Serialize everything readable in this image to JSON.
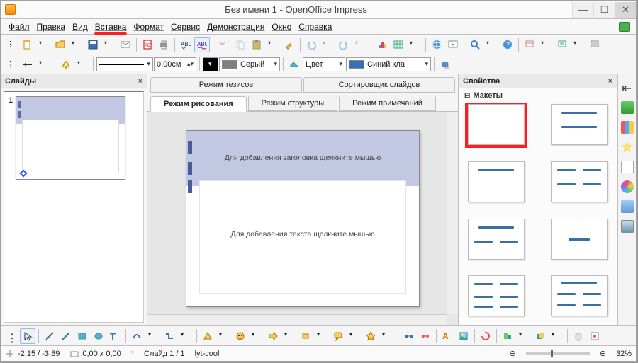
{
  "title": "Без имени 1 - OpenOffice Impress",
  "menu": {
    "items": [
      "Файл",
      "Правка",
      "Вид",
      "Вставка",
      "Формат",
      "Сервис",
      "Демонстрация",
      "Окно",
      "Справка"
    ],
    "underlined_index": 3
  },
  "panels": {
    "slides": "Слайды",
    "properties": "Свойства",
    "layouts_group": "Макеты"
  },
  "viewtabs": {
    "row1": [
      "Режим тезисов",
      "Сортировщик слайдов"
    ],
    "row2": [
      "Режим рисования",
      "Режим структуры",
      "Режим примечаний"
    ],
    "active": "Режим рисования"
  },
  "slide_thumb": {
    "num": "1"
  },
  "slide_content": {
    "title_placeholder": "Для добавления заголовка щелкните мышью",
    "body_placeholder": "Для добавления текста щелкните мышью"
  },
  "tb2": {
    "width_field": "0,00см",
    "fill_label": "Серый",
    "line_color_label": "Цвет",
    "shadow_color_label": "Синий кла"
  },
  "status": {
    "coords": "-2,15 / -3,89",
    "size": "0,00 x 0,00",
    "slide": "Слайд 1 / 1",
    "layout": "lyt-cool",
    "zoom": "32%"
  },
  "strip_items": [
    "cube",
    "chart",
    "star",
    "image",
    "colors",
    "gallery",
    "photo"
  ],
  "layouts": [
    {
      "id": "blank"
    },
    {
      "id": "title-content"
    },
    {
      "id": "title-only"
    },
    {
      "id": "two-content"
    },
    {
      "id": "title-two"
    },
    {
      "id": "centered"
    },
    {
      "id": "grid4"
    },
    {
      "id": "title-grid4"
    }
  ]
}
